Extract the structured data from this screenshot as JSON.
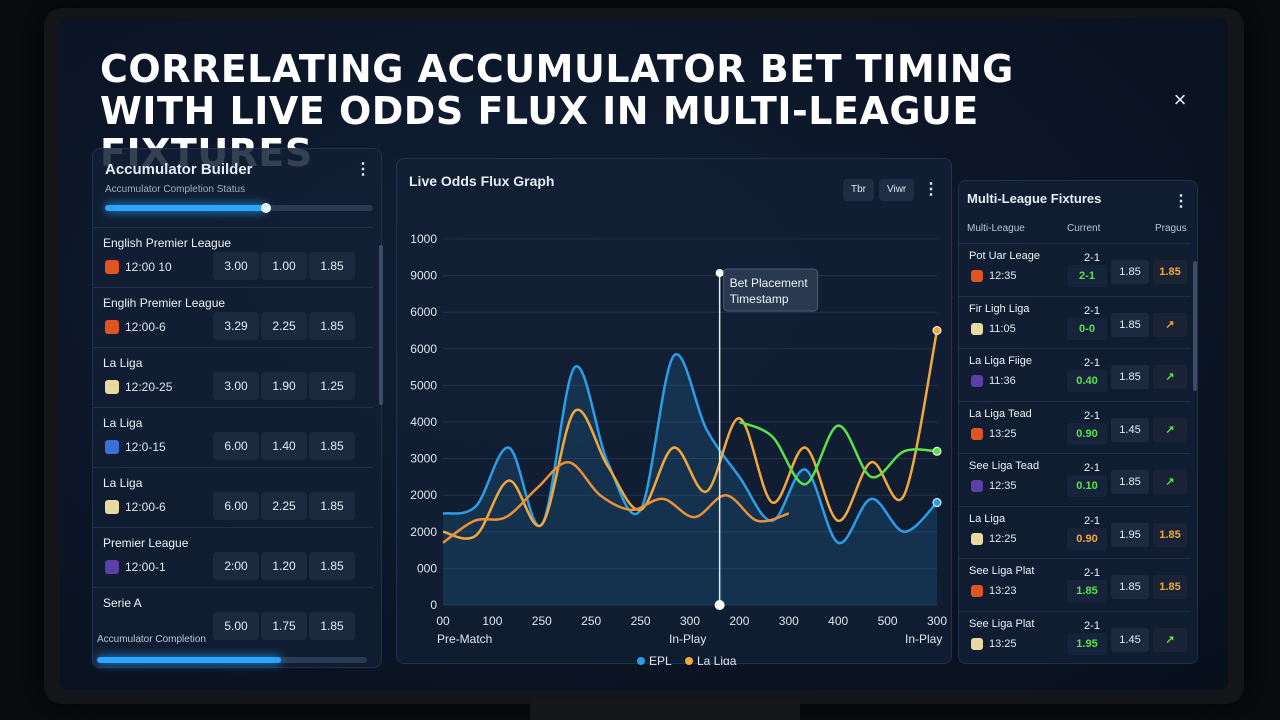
{
  "title": "CORRELATING ACCUMULATOR BET TIMING WITH LIVE ODDS FLUX IN MULTI-LEAGUE FIXTURES",
  "close_icon": "×",
  "builder": {
    "title": "Accumulator Builder",
    "subtitle": "Accumulator Completion Status",
    "progress_top": 0.6,
    "rows": [
      {
        "league": "English Premier League",
        "badge_color": "#e0551f",
        "time": "12:00 10",
        "odds": [
          "3.00",
          "1.00",
          "1.85"
        ]
      },
      {
        "league": "Englih Premier League",
        "badge_color": "#e0551f",
        "time": "12:00-6",
        "odds": [
          "3.29",
          "2.25",
          "1.85"
        ]
      },
      {
        "league": "La Liga",
        "badge_color": "#e8d9a0",
        "time": "12:20-25",
        "odds": [
          "3.00",
          "1.90",
          "1.25"
        ]
      },
      {
        "league": "La Liga",
        "badge_color": "#3a6fd8",
        "time": "12:0-15",
        "odds": [
          "6.00",
          "1.40",
          "1.85"
        ]
      },
      {
        "league": "La Liga",
        "badge_color": "#e8d9a0",
        "time": "12:00-6",
        "odds": [
          "6.00",
          "2.25",
          "1.85"
        ]
      },
      {
        "league": "Premier League",
        "badge_color": "#5a3fa8",
        "time": "12:00-1",
        "odds": [
          "2:00",
          "1.20",
          "1.85"
        ]
      },
      {
        "league": "Serie A",
        "badge_color": "",
        "time": "",
        "odds": [
          "5.00",
          "1.75",
          "1.85"
        ]
      }
    ],
    "footer_label": "Accumulator Completion",
    "progress_bottom": 0.68
  },
  "graph": {
    "title": "Live Odds Flux Graph",
    "chip1": "Tbr",
    "chip2": "Viwr",
    "annotation_line1": "Bet Placement",
    "annotation_line2": "Timestamp",
    "label_prematch": "Pre-Match",
    "label_inplay1": "In-Play",
    "label_inplay2": "In-Play"
  },
  "chart_data": {
    "type": "line",
    "title": "Live Odds Flux Graph",
    "y_ticks": [
      "1000",
      "9000",
      "6000",
      "6000",
      "5000",
      "4000",
      "3000",
      "2000",
      "2000",
      "000",
      "0"
    ],
    "x_ticks": [
      "00",
      "100",
      "250",
      "250",
      "250",
      "300",
      "200",
      "300",
      "400",
      "500",
      "300"
    ],
    "legend": [
      "EPL",
      "La Liga"
    ],
    "colors": {
      "epl": "#2b9ee8",
      "laliga": "#f2a93b",
      "orange2": "#e8913a",
      "green": "#5be24a"
    },
    "series": [
      {
        "name": "EPL",
        "values": [
          2500,
          2700,
          4300,
          2200,
          6500,
          3900,
          2600,
          6800,
          4800,
          3500,
          2300,
          3700,
          1700,
          2900,
          2000,
          2800
        ]
      },
      {
        "name": "La Liga",
        "values": [
          2000,
          1900,
          3400,
          2200,
          5300,
          3800,
          2600,
          4300,
          3100,
          5100,
          2800,
          4300,
          2300,
          3900,
          3000,
          7500
        ]
      },
      {
        "values": [
          1700,
          2300,
          2400,
          3200,
          3900,
          3000,
          2600,
          2900,
          2400,
          3000,
          2300,
          2500
        ]
      },
      {
        "values": [
          5000,
          4600,
          3300,
          4900,
          3500,
          4200,
          4200
        ]
      }
    ],
    "bet_placement_x_fraction": 0.56
  },
  "fixtures": {
    "title": "Multi-League Fixtures",
    "col_league": "Multi-League",
    "col_current": "Current",
    "col_pragus": "Pragus",
    "rows": [
      {
        "league": "Pot Uar Leage",
        "badge_color": "#e0551f",
        "time": "12:35",
        "score": "2-1",
        "live": "2-1",
        "live_color": "#5be24a",
        "odd": "1.85",
        "trend": "1.85",
        "trend_color": "#f2a93b"
      },
      {
        "league": "Fir Ligh Liga",
        "badge_color": "#e8d9a0",
        "time": "11:05",
        "score": "2-1",
        "live": "0-0",
        "live_color": "#5be24a",
        "odd": "1.85",
        "trend": "↗",
        "trend_color": "#f2a93b"
      },
      {
        "league": "La Liga Fiige",
        "badge_color": "#5a3fa8",
        "time": "11:36",
        "score": "2-1",
        "live": "0.40",
        "live_color": "#5be24a",
        "odd": "1.85",
        "trend": "↗",
        "trend_color": "#5be24a"
      },
      {
        "league": "La Liga Tead",
        "badge_color": "#e0551f",
        "time": "13:25",
        "score": "2-1",
        "live": "0.90",
        "live_color": "#5be24a",
        "odd": "1.45",
        "trend": "↗",
        "trend_color": "#5be24a"
      },
      {
        "league": "See Liga Tead",
        "badge_color": "#5a3fa8",
        "time": "12:35",
        "score": "2-1",
        "live": "0.10",
        "live_color": "#5be24a",
        "odd": "1.85",
        "trend": "↗",
        "trend_color": "#5be24a"
      },
      {
        "league": "La Liga",
        "badge_color": "#e8d9a0",
        "time": "12:25",
        "score": "2-1",
        "live": "0.90",
        "live_color": "#f2a93b",
        "odd": "1.95",
        "trend": "1.85",
        "trend_color": "#f2a93b"
      },
      {
        "league": "See Liga Plat",
        "badge_color": "#e0551f",
        "time": "13:23",
        "score": "2-1",
        "live": "1.85",
        "live_color": "#5be24a",
        "odd": "1.85",
        "trend": "1.85",
        "trend_color": "#f2a93b"
      },
      {
        "league": "See Liga Plat",
        "badge_color": "#e8d9a0",
        "time": "13:25",
        "score": "2-1",
        "live": "1.95",
        "live_color": "#5be24a",
        "odd": "1.45",
        "trend": "↗",
        "trend_color": "#5be24a"
      }
    ]
  }
}
